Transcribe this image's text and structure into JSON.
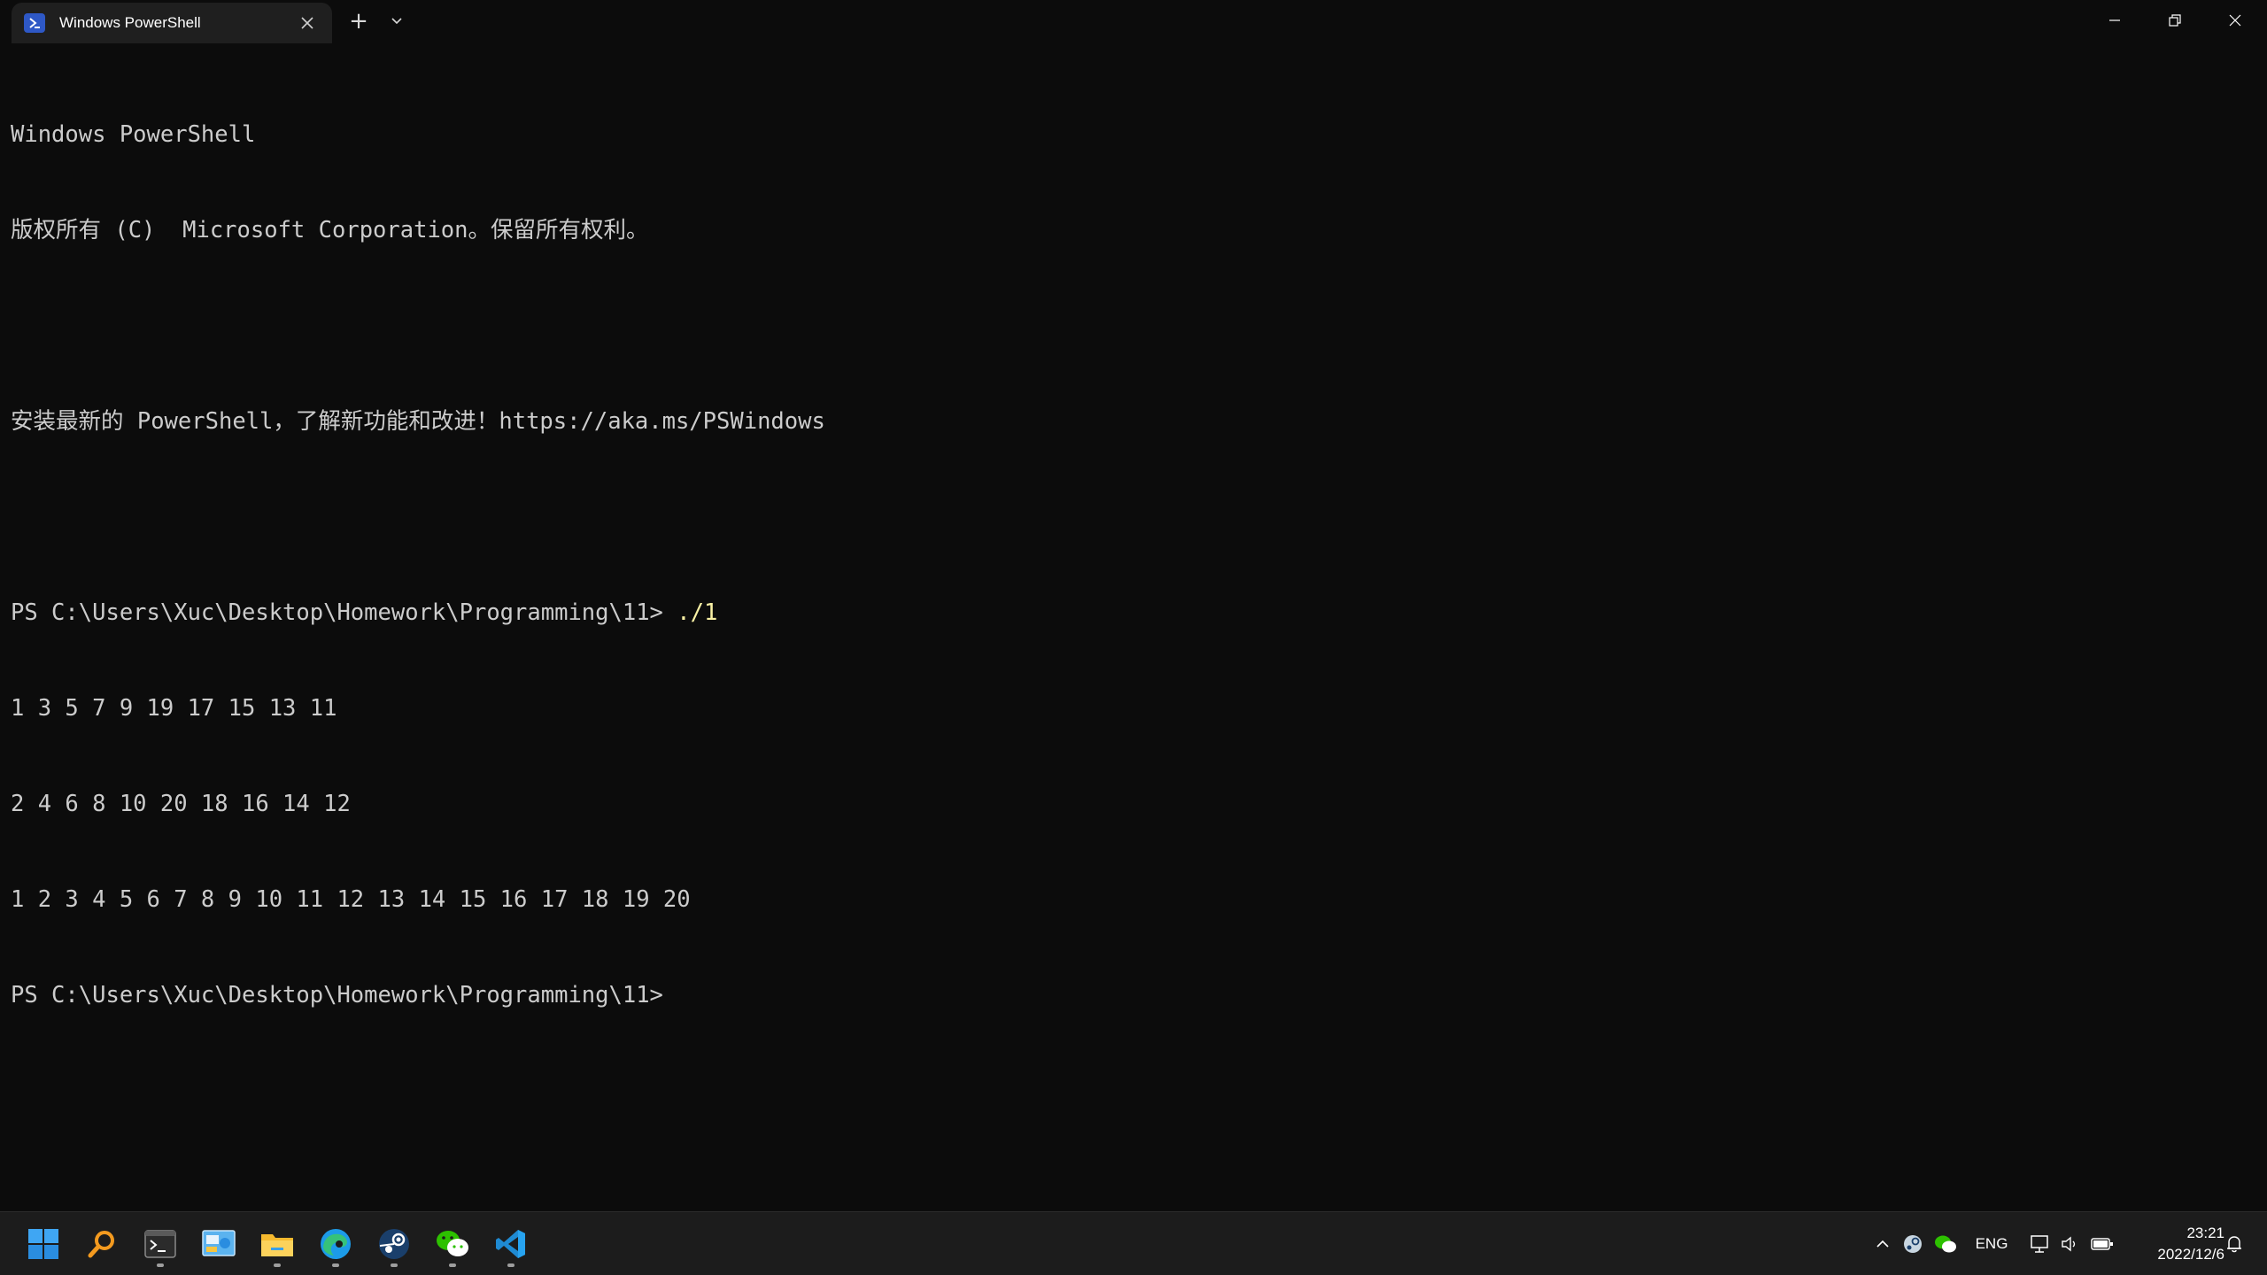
{
  "tab": {
    "title": "Windows PowerShell",
    "close_icon": "close-icon",
    "new_tab_label": "+"
  },
  "terminal": {
    "lines": [
      {
        "text": "Windows PowerShell"
      },
      {
        "text": "版权所有 (C)  Microsoft Corporation。保留所有权利。"
      },
      {
        "text": ""
      },
      {
        "text": "安装最新的 PowerShell，了解新功能和改进！https://aka.ms/PSWindows"
      },
      {
        "text": ""
      },
      {
        "prompt": "PS C:\\Users\\Xuc\\Desktop\\Homework\\Programming\\11> ",
        "command": "./1"
      },
      {
        "text": "1 3 5 7 9 19 17 15 13 11"
      },
      {
        "text": "2 4 6 8 10 20 18 16 14 12"
      },
      {
        "text": "1 2 3 4 5 6 7 8 9 10 11 12 13 14 15 16 17 18 19 20"
      },
      {
        "prompt": "PS C:\\Users\\Xuc\\Desktop\\Homework\\Programming\\11>",
        "command": ""
      }
    ]
  },
  "taskbar": {
    "apps": [
      "windows-start",
      "search",
      "terminal",
      "control-panel",
      "file-explorer",
      "edge",
      "steam",
      "wechat",
      "vscode"
    ],
    "tray": {
      "language": "ENG",
      "time": "23:21",
      "date": "2022/12/6"
    }
  },
  "colors": {
    "terminal_bg": "#0c0c0c",
    "terminal_fg": "#cccccc",
    "command": "#f9f1a5",
    "tab_active": "#1f1f1f",
    "taskbar_bg": "#1c1c1c"
  }
}
